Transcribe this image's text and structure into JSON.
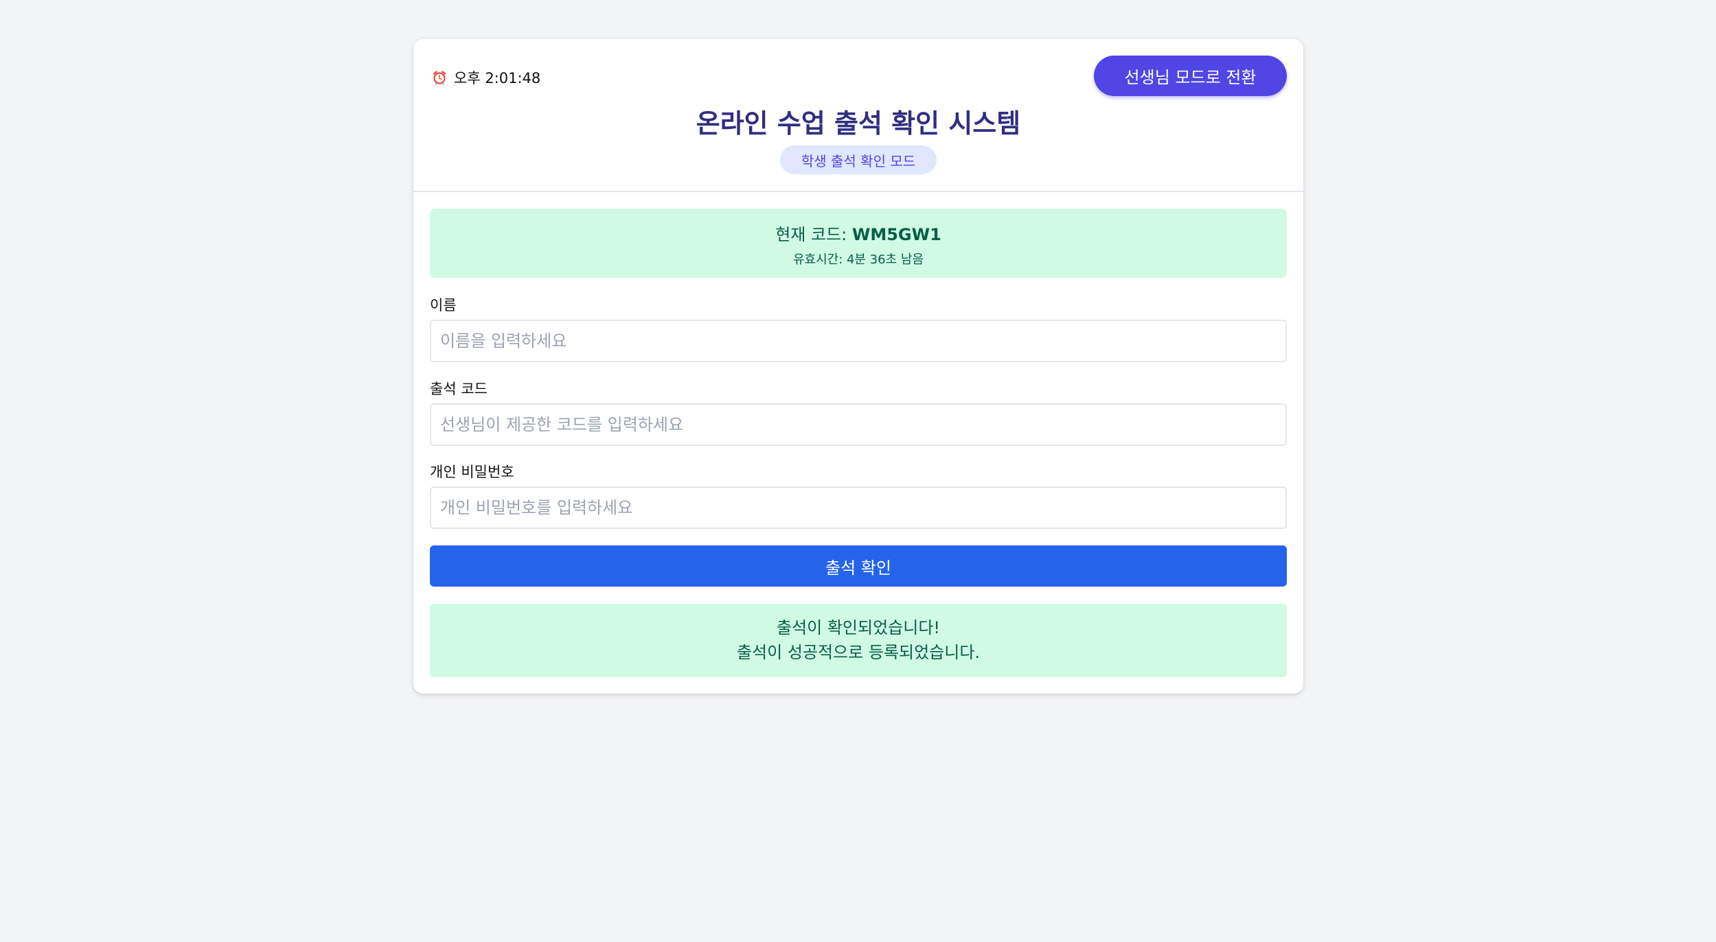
{
  "header": {
    "clock_time": "오후 2:01:48",
    "clock_icon": "alarm-clock-icon",
    "mode_switch_label": "선생님 모드로 전환",
    "title": "온라인 수업 출석 확인 시스템",
    "mode_badge": "학생 출석 확인 모드"
  },
  "current_code": {
    "label": "현재 코드: ",
    "value": "WM5GW1",
    "validity": "유효시간: 4분 36초 남음"
  },
  "form": {
    "name": {
      "label": "이름",
      "placeholder": "이름을 입력하세요",
      "value": ""
    },
    "code": {
      "label": "출석 코드",
      "placeholder": "선생님이 제공한 코드를 입력하세요",
      "value": ""
    },
    "password": {
      "label": "개인 비밀번호",
      "placeholder": "개인 비밀번호를 입력하세요",
      "value": ""
    },
    "submit_label": "출석 확인"
  },
  "result": {
    "line1": "출석이 확인되었습니다!",
    "line2": "출석이 성공적으로 등록되었습니다."
  },
  "colors": {
    "page_background": "#f3f4f6",
    "accent_indigo": "#4f46e5",
    "title_color": "#312e81",
    "badge_background": "#e0e7ff",
    "success_background": "#d1fae5",
    "success_text": "#065f46",
    "primary_button": "#2563eb"
  }
}
